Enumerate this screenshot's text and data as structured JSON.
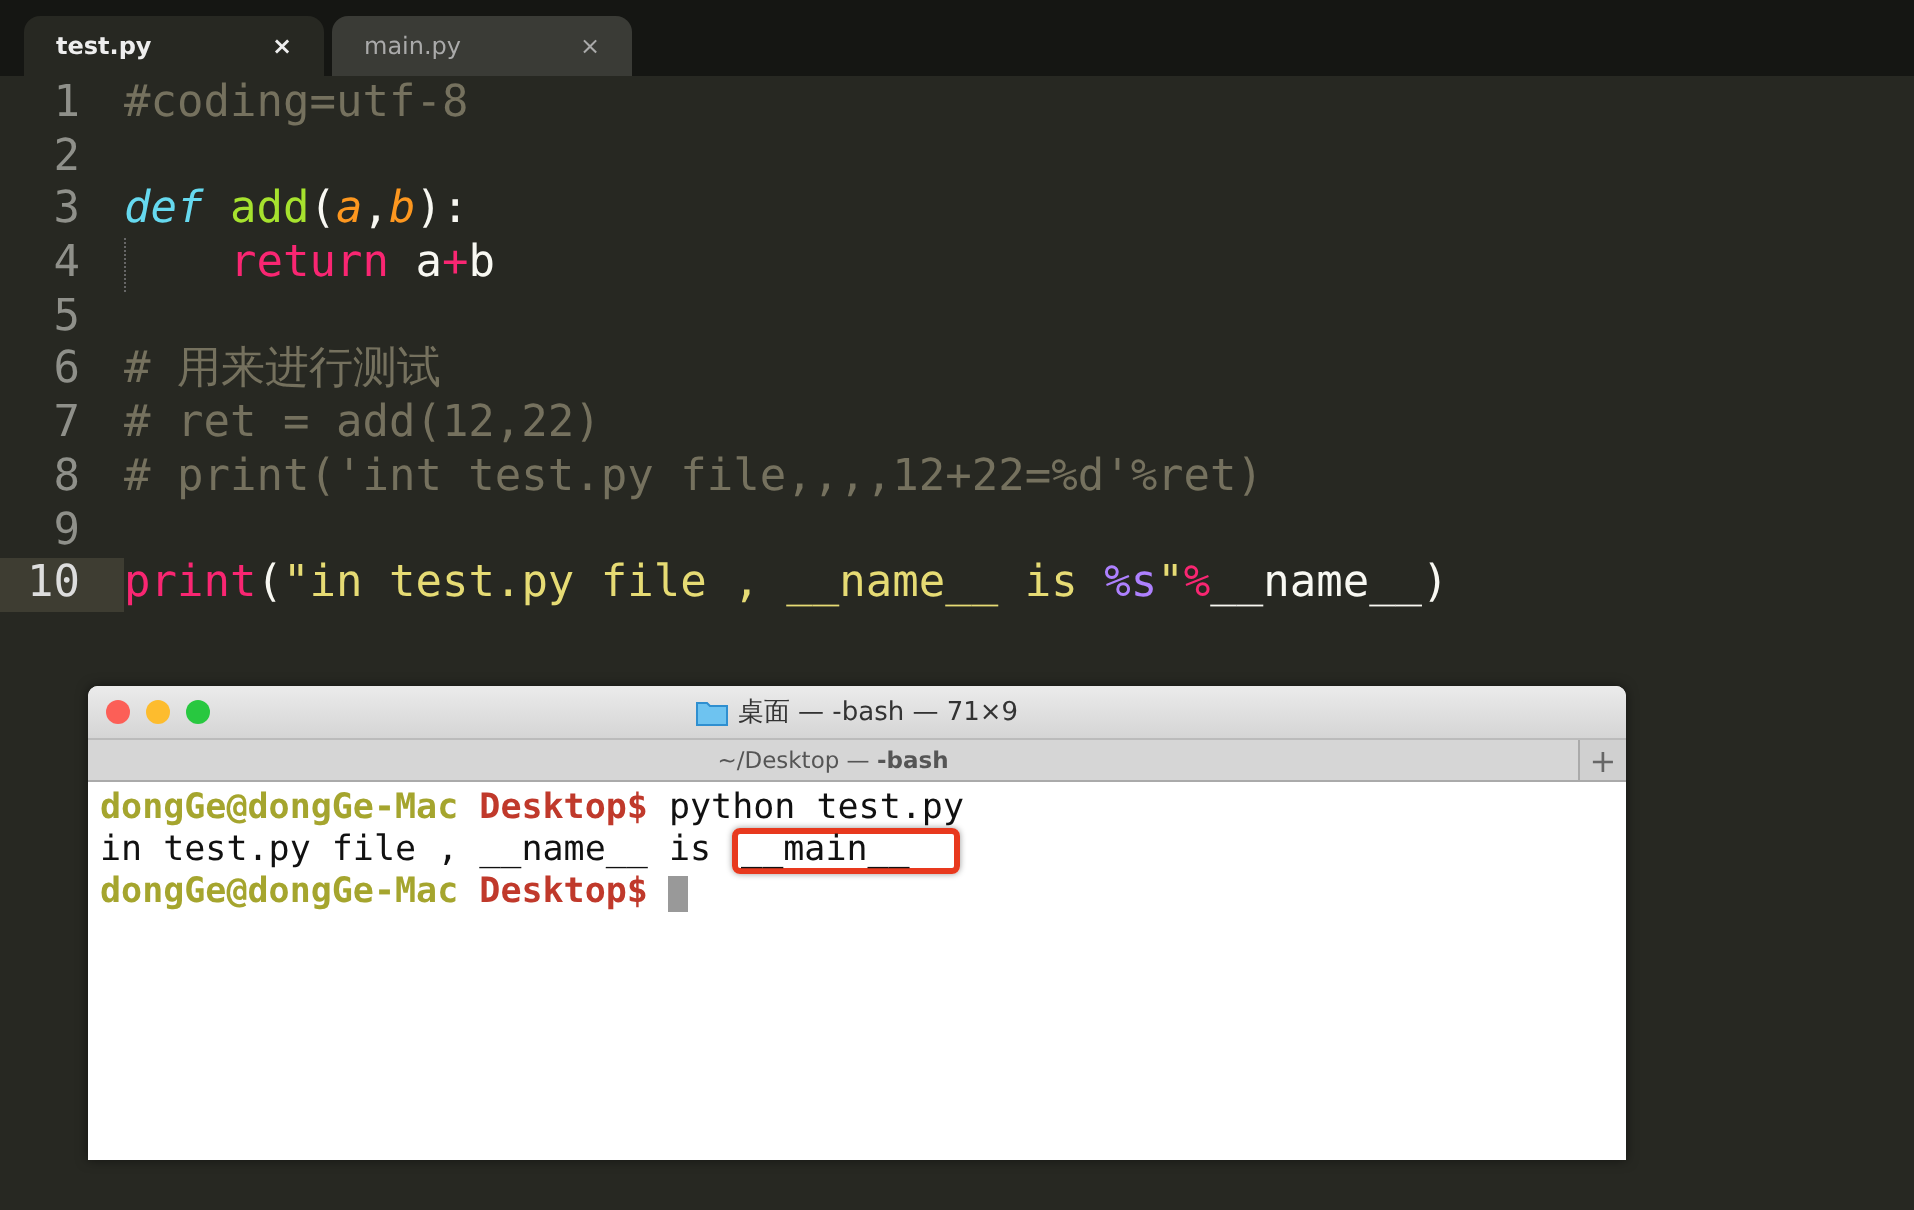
{
  "editor": {
    "tabs": [
      {
        "label": "test.py",
        "close": "×",
        "selected": true
      },
      {
        "label": "main.py",
        "close": "×",
        "selected": false
      }
    ],
    "lines": [
      {
        "number": "1",
        "current": false,
        "tokens": [
          {
            "text": "#coding=utf-8",
            "kind": "comment"
          }
        ]
      },
      {
        "number": "2",
        "current": false
      },
      {
        "number": "3",
        "current": false,
        "tokens": [
          {
            "text": "def",
            "kind": "keyword"
          },
          {
            "text": " add",
            "kind": "func"
          },
          {
            "text": "(",
            "kind": "plain"
          },
          {
            "text": "a",
            "kind": "param"
          },
          {
            "text": ",",
            "kind": "plain"
          },
          {
            "text": "b",
            "kind": "param"
          },
          {
            "text": "):",
            "kind": "plain"
          }
        ]
      },
      {
        "number": "4",
        "current": false,
        "indent": true,
        "tokens": [
          {
            "text": "return",
            "kind": "operator"
          },
          {
            "text": " a",
            "kind": "plain"
          },
          {
            "text": "+",
            "kind": "operator"
          },
          {
            "text": "b",
            "kind": "plain"
          }
        ]
      },
      {
        "number": "5",
        "current": false
      },
      {
        "number": "6",
        "current": false,
        "tokens": [
          {
            "text": "# 用来进行测试",
            "kind": "comment"
          }
        ]
      },
      {
        "number": "7",
        "current": false,
        "tokens": [
          {
            "text": "# ret = add(12,22)",
            "kind": "comment"
          }
        ]
      },
      {
        "number": "8",
        "current": false,
        "tokens": [
          {
            "text": "# print('int test.py file,,,,12+22=%d'%ret)",
            "kind": "comment"
          }
        ]
      },
      {
        "number": "9",
        "current": false
      },
      {
        "number": "10",
        "current": true,
        "tokens": [
          {
            "text": "print",
            "kind": "operator"
          },
          {
            "text": "(",
            "kind": "plain"
          },
          {
            "text": "\"in test.py file , __name__ is ",
            "kind": "string"
          },
          {
            "text": "%s",
            "kind": "format"
          },
          {
            "text": "\"",
            "kind": "string"
          },
          {
            "text": "%",
            "kind": "operator"
          },
          {
            "text": "__name__)",
            "kind": "plain"
          }
        ]
      }
    ]
  },
  "terminal": {
    "title": "桌面 — -bash — 71×9",
    "tab_title": "~/Desktop — **-bash**",
    "new_tab": "+",
    "lines": [
      {
        "tokens": [
          {
            "text": "dongGe@dongGe-Mac",
            "kind": "user"
          },
          {
            "text": " Desktop$",
            "kind": "dir"
          },
          {
            "text": " python test.py",
            "kind": "plain"
          }
        ]
      },
      {
        "tokens": [
          {
            "text": "in test.py file , __name__ is",
            "kind": "plain",
            "highlighted": false
          },
          {
            "text": "__main__",
            "kind": "plain",
            "highlighted": true
          }
        ]
      },
      {
        "tokens": [
          {
            "text": "dongGe@dongGe-Mac",
            "kind": "user"
          },
          {
            "text": " Desktop$",
            "kind": "dir"
          }
        ],
        "cursor": true
      }
    ]
  }
}
